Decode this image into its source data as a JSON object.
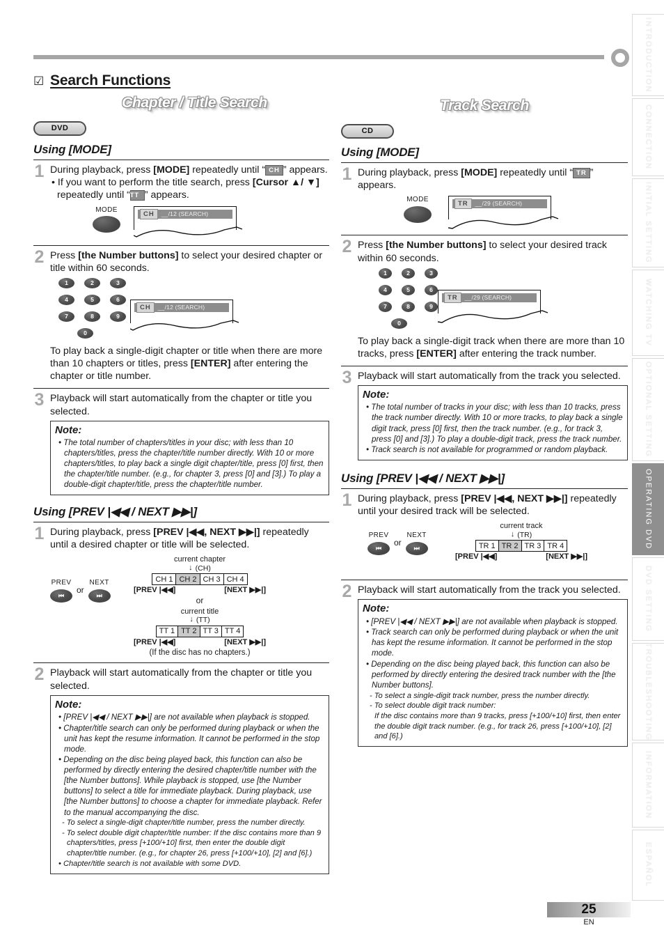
{
  "section": {
    "check_icon": "☑",
    "title": "Search Functions"
  },
  "left": {
    "banner": "Chapter / Title Search",
    "disc_badge": "DVD",
    "using_mode": "Using [MODE]",
    "using_prevnext": "Using [PREV |◀◀ / NEXT ▶▶|]",
    "step1": {
      "num": "1",
      "line1_a": "During playback, press ",
      "line1_b": "[MODE]",
      "line1_c": " repeatedly until “",
      "chip1": "CH",
      "line1_d": "” appears.",
      "bullet_a": "• If you want to perform the title search, press ",
      "bullet_b": "[Cursor ▲/ ▼]",
      "bullet_c": " repeatedly until “",
      "chip2": "TT",
      "bullet_d": "” appears."
    },
    "mode_button_label": "MODE",
    "osd1": {
      "chip": "CH",
      "text": "__/12 (SEARCH)"
    },
    "step2": {
      "num": "2",
      "a": "Press ",
      "b": "[the Number buttons]",
      "c": " to select your desired chapter or title within 60 seconds.",
      "tail_a": "To play back a single-digit chapter or title when there are more than 10 chapters or titles, press ",
      "tail_b": "[ENTER]",
      "tail_c": " after entering the chapter or title number."
    },
    "osd2": {
      "chip": "CH",
      "text": "__/12 (SEARCH)"
    },
    "step3": {
      "num": "3",
      "text": "Playback will start automatically from the chapter or title you selected."
    },
    "note1": {
      "heading": "Note:",
      "items": [
        "• The total number of chapters/titles in your disc; with less than 10 chapters/titles, press the chapter/title number directly. With 10 or more chapters/titles, to play back a single digit chapter/title, press [0] first, then the chapter/title number. (e.g., for chapter 3, press [0] and [3].) To play a double-digit chapter/title, press the chapter/title number."
      ]
    },
    "pn_step1": {
      "num": "1",
      "a": "During playback, press ",
      "b": "[PREV |◀◀, NEXT ▶▶|]",
      "c": " repeatedly until a desired chapter or title will be selected."
    },
    "remote": {
      "prev_label": "PREV",
      "next_label": "NEXT",
      "or": "or",
      "prev_glyph": "⏮",
      "next_glyph": "⏭"
    },
    "chain_chapter": {
      "caption": "current chapter",
      "code": "(CH)",
      "cells": [
        "CH 1",
        "CH 2",
        "CH 3",
        "CH 4"
      ],
      "current_index": 1,
      "left_end": "[PREV |◀◀]",
      "right_end": "[NEXT ▶▶|]"
    },
    "chain_or": "or",
    "chain_title": {
      "caption": "current title",
      "code": "(TT)",
      "cells": [
        "TT 1",
        "TT 2",
        "TT 3",
        "TT 4"
      ],
      "current_index": 1,
      "left_end": "[PREV |◀◀]",
      "right_end": "[NEXT ▶▶|]",
      "footnote": "(If the disc has no chapters.)"
    },
    "pn_step2": {
      "num": "2",
      "text": "Playback will start automatically from the chapter or title you selected."
    },
    "note2": {
      "heading": "Note:",
      "items": [
        "• [PREV |◀◀ / NEXT ▶▶|] are not available when playback is stopped.",
        "• Chapter/title search can only be performed during playback or when the unit has kept the resume information. It cannot be performed in the stop mode.",
        "• Depending on the disc being played back, this function can also be performed by directly entering the desired chapter/title number with the [the Number buttons]. While playback is stopped, use [the Number buttons] to select a title for immediate playback. During playback, use [the Number buttons] to choose a chapter for immediate playback. Refer to the manual accompanying the disc.",
        "- To select a single-digit chapter/title number, press the number directly.",
        "- To select double digit chapter/title number: If the disc contains more than 9 chapters/titles, press [+100/+10] first, then enter the double digit chapter/title number. (e.g., for chapter 26, press [+100/+10], [2] and [6].)",
        "• Chapter/title search is not available with some DVD."
      ]
    }
  },
  "right": {
    "banner": "Track Search",
    "disc_badge": "CD",
    "using_mode": "Using [MODE]",
    "using_prevnext": "Using [PREV |◀◀ / NEXT ▶▶|]",
    "step1": {
      "num": "1",
      "line1_a": "During playback, press ",
      "line1_b": "[MODE]",
      "line1_c": " repeatedly until “",
      "chip1": "TR",
      "line1_d": "” appears."
    },
    "mode_button_label": "MODE",
    "osd1": {
      "chip": "TR",
      "text": "__/29 (SEARCH)"
    },
    "step2": {
      "num": "2",
      "a": "Press ",
      "b": "[the Number buttons]",
      "c": " to select your desired track within 60 seconds.",
      "tail_a": "To play back a single-digit track when there are more than 10 tracks, press ",
      "tail_b": "[ENTER]",
      "tail_c": " after entering the track number."
    },
    "osd2": {
      "chip": "TR",
      "text": "__/29 (SEARCH)"
    },
    "step3": {
      "num": "3",
      "text": "Playback will start automatically from the track you selected."
    },
    "note1": {
      "heading": "Note:",
      "items": [
        "• The total number of tracks in your disc; with less than 10 tracks, press the track number directly.  With 10 or more tracks, to play back a single digit track, press [0] first, then the track number. (e.g., for track 3, press [0] and [3].)  To play a double-digit track, press the track number.",
        "• Track search is not available for programmed or random playback."
      ]
    },
    "pn_step1": {
      "num": "1",
      "a": "During playback, press ",
      "b": "[PREV |◀◀, NEXT ▶▶|]",
      "c": " repeatedly until your desired track will be selected."
    },
    "remote": {
      "prev_label": "PREV",
      "next_label": "NEXT",
      "or": "or",
      "prev_glyph": "⏮",
      "next_glyph": "⏭"
    },
    "chain_track": {
      "caption": "current track",
      "code": "(TR)",
      "cells": [
        "TR 1",
        "TR 2",
        "TR 3",
        "TR 4"
      ],
      "current_index": 1,
      "left_end": "[PREV |◀◀]",
      "right_end": "[NEXT ▶▶|]"
    },
    "pn_step2": {
      "num": "2",
      "text": "Playback will start automatically from the track you selected."
    },
    "note2": {
      "heading": "Note:",
      "items": [
        "• [PREV |◀◀ / NEXT ▶▶|] are not available when playback is stopped.",
        "• Track search can only be performed during playback or when the unit has kept the resume information. It cannot be performed in the stop mode.",
        "• Depending on the disc being played back, this function can also be performed by directly entering the desired track number with the [the Number buttons].",
        "- To select a single-digit track number, press the number directly.",
        "- To select double digit track number:",
        "If the disc contains more than 9 tracks, press [+100/+10] first, then enter the double digit track number. (e.g., for track 26, press [+100/+10], [2] and [6].)"
      ]
    }
  },
  "tabs": [
    {
      "label": "INTRODUCTION",
      "active": false
    },
    {
      "label": "CONNECTION",
      "active": false
    },
    {
      "label": "INITIAL  SETTING",
      "active": false
    },
    {
      "label": "WATCHING  TV",
      "active": false
    },
    {
      "label": "OPTIONAL  SETTING",
      "active": false
    },
    {
      "label": "OPERATING  DVD",
      "active": true
    },
    {
      "label": "DVD  SETTING",
      "active": false
    },
    {
      "label": "TROUBLESHOOTING",
      "active": false
    },
    {
      "label": "INFORMATION",
      "active": false
    },
    {
      "label": "ESPAÑOL",
      "active": false
    }
  ],
  "footer": {
    "page_number": "25",
    "language": "EN"
  }
}
